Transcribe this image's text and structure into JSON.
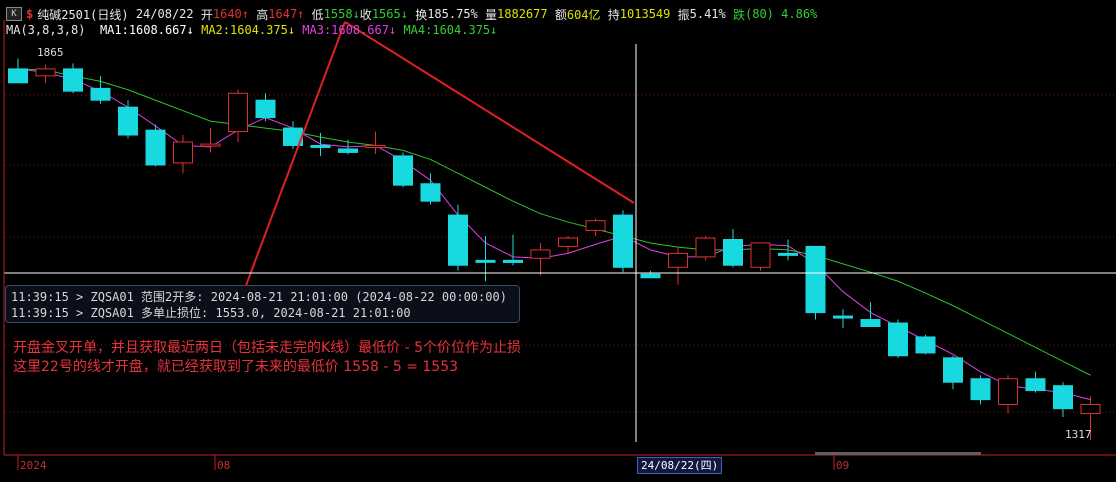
{
  "header": {
    "name": "纯碱2501(日线)",
    "date": "24/08/22",
    "open_label": "开",
    "open": "1640",
    "open_arrow": "↑",
    "high_label": "高",
    "high": "1647",
    "high_arrow": "↑",
    "low_label": "低",
    "low": "1558",
    "low_arrow": "↓",
    "close_label": "收",
    "close": "1565",
    "close_arrow": "↓",
    "turnover_label": "换",
    "turnover": "185.75%",
    "volume_label": "量",
    "volume": "1882677",
    "amount_label": "额",
    "amount": "604亿",
    "oi_label": "持",
    "oi": "1013549",
    "amp_label": "振",
    "amp": "5.41%",
    "change_label": "跌",
    "change": "(80)",
    "change_pct": "4.86%"
  },
  "ma_row": {
    "params": "MA(3,8,3,8)",
    "ma1": "MA1:1608.667",
    "ma1_arrow": "↓",
    "ma2": "MA2:1604.375",
    "ma2_arrow": "↓",
    "ma3": "MA3:1608.667",
    "ma3_arrow": "↓",
    "ma4": "MA4:1604.375",
    "ma4_arrow": "↓"
  },
  "messages": [
    "11:39:15 > ZQSA01 范围2开多: 2024-08-21 21:01:00 (2024-08-22 00:00:00)",
    "11:39:15 > ZQSA01 多单止损位: 1553.0, 2024-08-21 21:01:00"
  ],
  "notes": [
    "开盘金叉开单，并且获取最近两日（包括未走完的K线）最低价 - 5个价位作为止损",
    "这里22号的线才开盘，就已经获取到了未来的最低价 1558 - 5 = 1553"
  ],
  "price_labels": {
    "max": "1865",
    "min": "1317"
  },
  "axis_labels": {
    "year": "2024",
    "m08": "08",
    "cursor": "24/08/22(四)",
    "m09": "09"
  },
  "colors": {
    "up": "#e03030",
    "down": "#18d8e0",
    "ma_fast": "#e040e0",
    "ma_slow": "#30c030",
    "red_line": "#e02020",
    "cursor": "#ffffff",
    "header_up": "#e03030",
    "header_down": "#30d030",
    "ma1": "#ffffff",
    "ma2": "#e0e000",
    "ma3": "#e040e0",
    "ma4": "#30d030"
  },
  "chart_data": {
    "type": "candlestick",
    "ylim": [
      1317,
      1880
    ],
    "candles": [
      {
        "o": 1850,
        "h": 1865,
        "l": 1835,
        "c": 1830
      },
      {
        "o": 1840,
        "h": 1856,
        "l": 1830,
        "c": 1850
      },
      {
        "o": 1850,
        "h": 1858,
        "l": 1815,
        "c": 1818
      },
      {
        "o": 1822,
        "h": 1840,
        "l": 1800,
        "c": 1805
      },
      {
        "o": 1795,
        "h": 1805,
        "l": 1750,
        "c": 1755
      },
      {
        "o": 1762,
        "h": 1770,
        "l": 1710,
        "c": 1712
      },
      {
        "o": 1715,
        "h": 1755,
        "l": 1700,
        "c": 1745
      },
      {
        "o": 1740,
        "h": 1765,
        "l": 1730,
        "c": 1742
      },
      {
        "o": 1760,
        "h": 1820,
        "l": 1745,
        "c": 1815
      },
      {
        "o": 1805,
        "h": 1815,
        "l": 1775,
        "c": 1780
      },
      {
        "o": 1765,
        "h": 1775,
        "l": 1735,
        "c": 1740
      },
      {
        "o": 1740,
        "h": 1758,
        "l": 1725,
        "c": 1740
      },
      {
        "o": 1735,
        "h": 1748,
        "l": 1727,
        "c": 1730
      },
      {
        "o": 1738,
        "h": 1760,
        "l": 1728,
        "c": 1740
      },
      {
        "o": 1725,
        "h": 1730,
        "l": 1680,
        "c": 1683
      },
      {
        "o": 1685,
        "h": 1700,
        "l": 1655,
        "c": 1660
      },
      {
        "o": 1640,
        "h": 1655,
        "l": 1560,
        "c": 1568
      },
      {
        "o": 1575,
        "h": 1610,
        "l": 1545,
        "c": 1575
      },
      {
        "o": 1575,
        "h": 1612,
        "l": 1568,
        "c": 1572
      },
      {
        "o": 1578,
        "h": 1600,
        "l": 1553,
        "c": 1590
      },
      {
        "o": 1595,
        "h": 1610,
        "l": 1585,
        "c": 1607
      },
      {
        "o": 1618,
        "h": 1635,
        "l": 1610,
        "c": 1632
      },
      {
        "o": 1640,
        "h": 1647,
        "l": 1558,
        "c": 1565
      },
      {
        "o": 1555,
        "h": 1560,
        "l": 1550,
        "c": 1550
      },
      {
        "o": 1565,
        "h": 1595,
        "l": 1540,
        "c": 1585
      },
      {
        "o": 1580,
        "h": 1610,
        "l": 1575,
        "c": 1607
      },
      {
        "o": 1605,
        "h": 1620,
        "l": 1565,
        "c": 1568
      },
      {
        "o": 1565,
        "h": 1600,
        "l": 1560,
        "c": 1600
      },
      {
        "o": 1585,
        "h": 1605,
        "l": 1575,
        "c": 1585
      },
      {
        "o": 1595,
        "h": 1595,
        "l": 1490,
        "c": 1500
      },
      {
        "o": 1495,
        "h": 1505,
        "l": 1478,
        "c": 1493
      },
      {
        "o": 1490,
        "h": 1515,
        "l": 1480,
        "c": 1480
      },
      {
        "o": 1485,
        "h": 1490,
        "l": 1435,
        "c": 1438
      },
      {
        "o": 1465,
        "h": 1468,
        "l": 1440,
        "c": 1442
      },
      {
        "o": 1435,
        "h": 1438,
        "l": 1390,
        "c": 1400
      },
      {
        "o": 1405,
        "h": 1410,
        "l": 1368,
        "c": 1375
      },
      {
        "o": 1368,
        "h": 1410,
        "l": 1355,
        "c": 1405
      },
      {
        "o": 1405,
        "h": 1415,
        "l": 1385,
        "c": 1388
      },
      {
        "o": 1395,
        "h": 1400,
        "l": 1350,
        "c": 1362
      },
      {
        "o": 1355,
        "h": 1380,
        "l": 1317,
        "c": 1368
      }
    ],
    "ma_fast": [
      1850,
      1845,
      1835,
      1818,
      1795,
      1768,
      1740,
      1738,
      1762,
      1780,
      1765,
      1742,
      1738,
      1740,
      1718,
      1690,
      1640,
      1600,
      1580,
      1578,
      1585,
      1598,
      1610,
      1590,
      1580,
      1580,
      1595,
      1598,
      1596,
      1570,
      1530,
      1500,
      1480,
      1460,
      1440,
      1415,
      1395,
      1390,
      1385,
      1375
    ],
    "ma_slow": [
      1850,
      1848,
      1840,
      1832,
      1820,
      1805,
      1790,
      1775,
      1770,
      1765,
      1760,
      1752,
      1745,
      1740,
      1733,
      1720,
      1700,
      1680,
      1660,
      1642,
      1630,
      1620,
      1610,
      1600,
      1594,
      1590,
      1590,
      1592,
      1590,
      1582,
      1570,
      1558,
      1545,
      1528,
      1510,
      1490,
      1470,
      1450,
      1430,
      1410
    ]
  }
}
